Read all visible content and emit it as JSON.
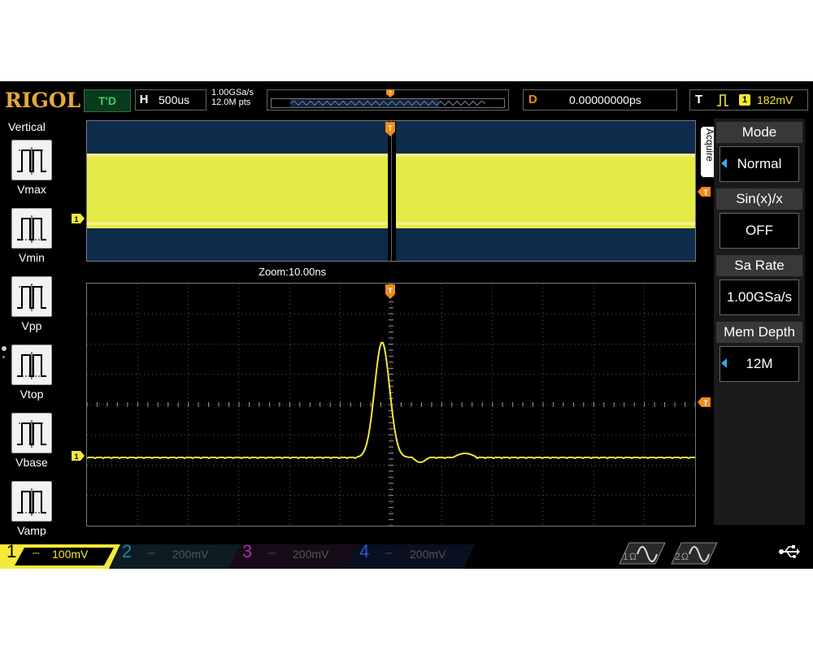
{
  "topbar": {
    "brand": "RIGOL",
    "run_status": "T'D",
    "horizontal": {
      "letter": "H",
      "timebase": "500us"
    },
    "sample_rate": "1.00GSa/s",
    "memory_points": "12.0M pts",
    "delay": {
      "letter": "D",
      "value": "0.00000000ps"
    },
    "trigger": {
      "letter": "T",
      "edge_symbol": "⎍",
      "channel": "1",
      "level": "182mV"
    }
  },
  "left_menu": {
    "title": "Vertical",
    "items": [
      {
        "label": "Vmax",
        "icon": "vmax-icon"
      },
      {
        "label": "Vmin",
        "icon": "vmin-icon"
      },
      {
        "label": "Vpp",
        "icon": "vpp-icon"
      },
      {
        "label": "Vtop",
        "icon": "vtop-icon"
      },
      {
        "label": "Vbase",
        "icon": "vbase-icon"
      },
      {
        "label": "Vamp",
        "icon": "vamp-icon"
      }
    ]
  },
  "display": {
    "zoom_label": "Zoom:10.00ns",
    "trace_color": "#f5e83a",
    "marker_color": "#f08a1a",
    "channel_marker": "1",
    "trigger_marker": "T"
  },
  "right_menu": {
    "tab_label": "Acquire",
    "items": [
      {
        "title": "Mode",
        "value": "Normal",
        "has_arrow": true
      },
      {
        "title": "Sin(x)/x",
        "value": "OFF",
        "has_arrow": false
      },
      {
        "title": "Sa Rate",
        "value": "1.00GSa/s",
        "has_arrow": false
      },
      {
        "title": "Mem Depth",
        "value": "12M",
        "has_arrow": true
      }
    ]
  },
  "channels": [
    {
      "num": "1",
      "coupling": "⎓",
      "scale": "100mV",
      "color": "#f5e83a",
      "active": true
    },
    {
      "num": "2",
      "coupling": "⎓",
      "scale": "200mV",
      "color": "#1f8aa0",
      "active": false
    },
    {
      "num": "3",
      "coupling": "⎓",
      "scale": "200mV",
      "color": "#b02aa8",
      "active": false
    },
    {
      "num": "4",
      "coupling": "⎓",
      "scale": "200mV",
      "color": "#2a5ad0",
      "active": false
    }
  ],
  "generators": [
    {
      "num": "1",
      "unit": "Ω"
    },
    {
      "num": "2",
      "unit": "Ω"
    }
  ],
  "status": {
    "usb_icon": "usb-icon"
  }
}
